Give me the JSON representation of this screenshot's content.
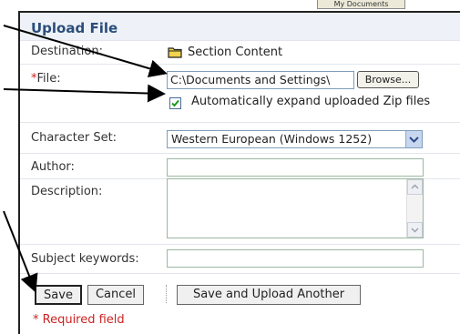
{
  "background_tab": {
    "label": "My Documents"
  },
  "dialog": {
    "title": "Upload File",
    "destination": {
      "label": "Destination:",
      "value": "Section Content"
    },
    "file": {
      "required_marker": "*",
      "label": "File:",
      "value": "C:\\Documents and Settings\\",
      "browse_label": "Browse..."
    },
    "auto_expand": {
      "label": "Automatically expand uploaded Zip files",
      "checked": true
    },
    "charset": {
      "label": "Character Set:",
      "value": "Western European (Windows 1252)"
    },
    "author": {
      "label": "Author:",
      "value": ""
    },
    "description": {
      "label": "Description:",
      "value": ""
    },
    "keywords": {
      "label": "Subject keywords:",
      "value": ""
    },
    "buttons": {
      "save": "Save",
      "cancel": "Cancel",
      "save_upload_another": "Save and Upload Another"
    },
    "required_note": "* Required field"
  },
  "colors": {
    "title": "#2b4d7a",
    "required": "#cc2222",
    "field_border": "#9bb8a0"
  }
}
